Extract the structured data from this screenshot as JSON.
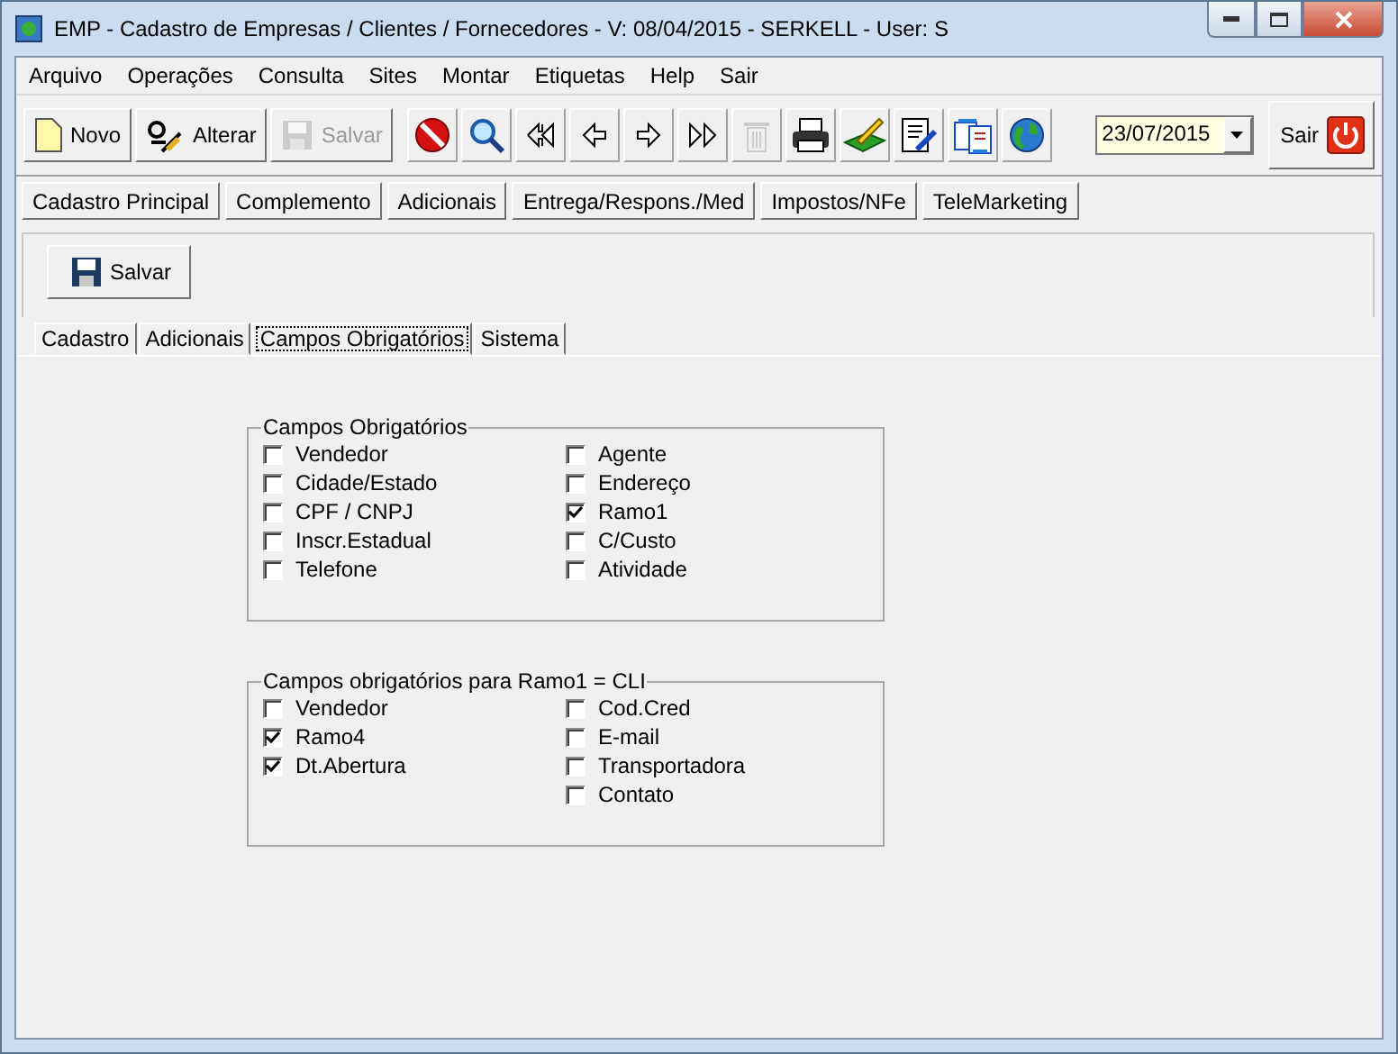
{
  "window": {
    "title": "EMP - Cadastro de Empresas / Clientes / Fornecedores - V: 08/04/2015 - SERKELL - User: S"
  },
  "menu": [
    "Arquivo",
    "Operações",
    "Consulta",
    "Sites",
    "Montar",
    "Etiquetas",
    "Help",
    "Sair"
  ],
  "toolbar": {
    "buttons": [
      {
        "kind": "new",
        "label": "Novo",
        "disabled": false
      },
      {
        "kind": "edit",
        "label": "Alterar",
        "disabled": false
      },
      {
        "kind": "save",
        "label": "Salvar",
        "disabled": true
      }
    ],
    "icons": [
      {
        "kind": "stop",
        "disabled": false
      },
      {
        "kind": "search",
        "disabled": false
      },
      {
        "kind": "first",
        "disabled": false
      },
      {
        "kind": "prev",
        "disabled": false
      },
      {
        "kind": "next",
        "disabled": false
      },
      {
        "kind": "last",
        "disabled": false
      },
      {
        "kind": "trash",
        "disabled": true
      },
      {
        "kind": "print",
        "disabled": false
      },
      {
        "kind": "pen",
        "disabled": false
      },
      {
        "kind": "document",
        "disabled": false
      },
      {
        "kind": "transfer",
        "disabled": false
      },
      {
        "kind": "globe",
        "disabled": false
      }
    ],
    "date": "23/07/2015",
    "exit": "Sair"
  },
  "sections": [
    "Cadastro Principal",
    "Complemento",
    "Adicionais",
    "Entrega/Respons./Med",
    "Impostos/NFe",
    "TeleMarketing"
  ],
  "save_button": "Salvar",
  "tabs": [
    {
      "label": "Cadastro",
      "selected": false
    },
    {
      "label": "Adicionais",
      "selected": false
    },
    {
      "label": "Campos Obrigatórios",
      "selected": true
    },
    {
      "label": "Sistema",
      "selected": false
    }
  ],
  "groups": [
    {
      "title": "Campos Obrigatórios",
      "columns": [
        [
          {
            "label": "Vendedor",
            "checked": false
          },
          {
            "label": "Cidade/Estado",
            "checked": false
          },
          {
            "label": "CPF / CNPJ",
            "checked": false
          },
          {
            "label": "Inscr.Estadual",
            "checked": false
          },
          {
            "label": "Telefone",
            "checked": false
          }
        ],
        [
          {
            "label": "Agente",
            "checked": false
          },
          {
            "label": "Endereço",
            "checked": false
          },
          {
            "label": "Ramo1",
            "checked": true
          },
          {
            "label": "C/Custo",
            "checked": false
          },
          {
            "label": "Atividade",
            "checked": false
          }
        ]
      ]
    },
    {
      "title": "Campos obrigatórios para Ramo1 = CLI",
      "columns": [
        [
          {
            "label": "Vendedor",
            "checked": false
          },
          {
            "label": "Ramo4",
            "checked": true
          },
          {
            "label": "Dt.Abertura",
            "checked": true
          }
        ],
        [
          {
            "label": "Cod.Cred",
            "checked": false
          },
          {
            "label": "E-mail",
            "checked": false
          },
          {
            "label": "Transportadora",
            "checked": false
          },
          {
            "label": "Contato",
            "checked": false
          }
        ]
      ]
    }
  ]
}
